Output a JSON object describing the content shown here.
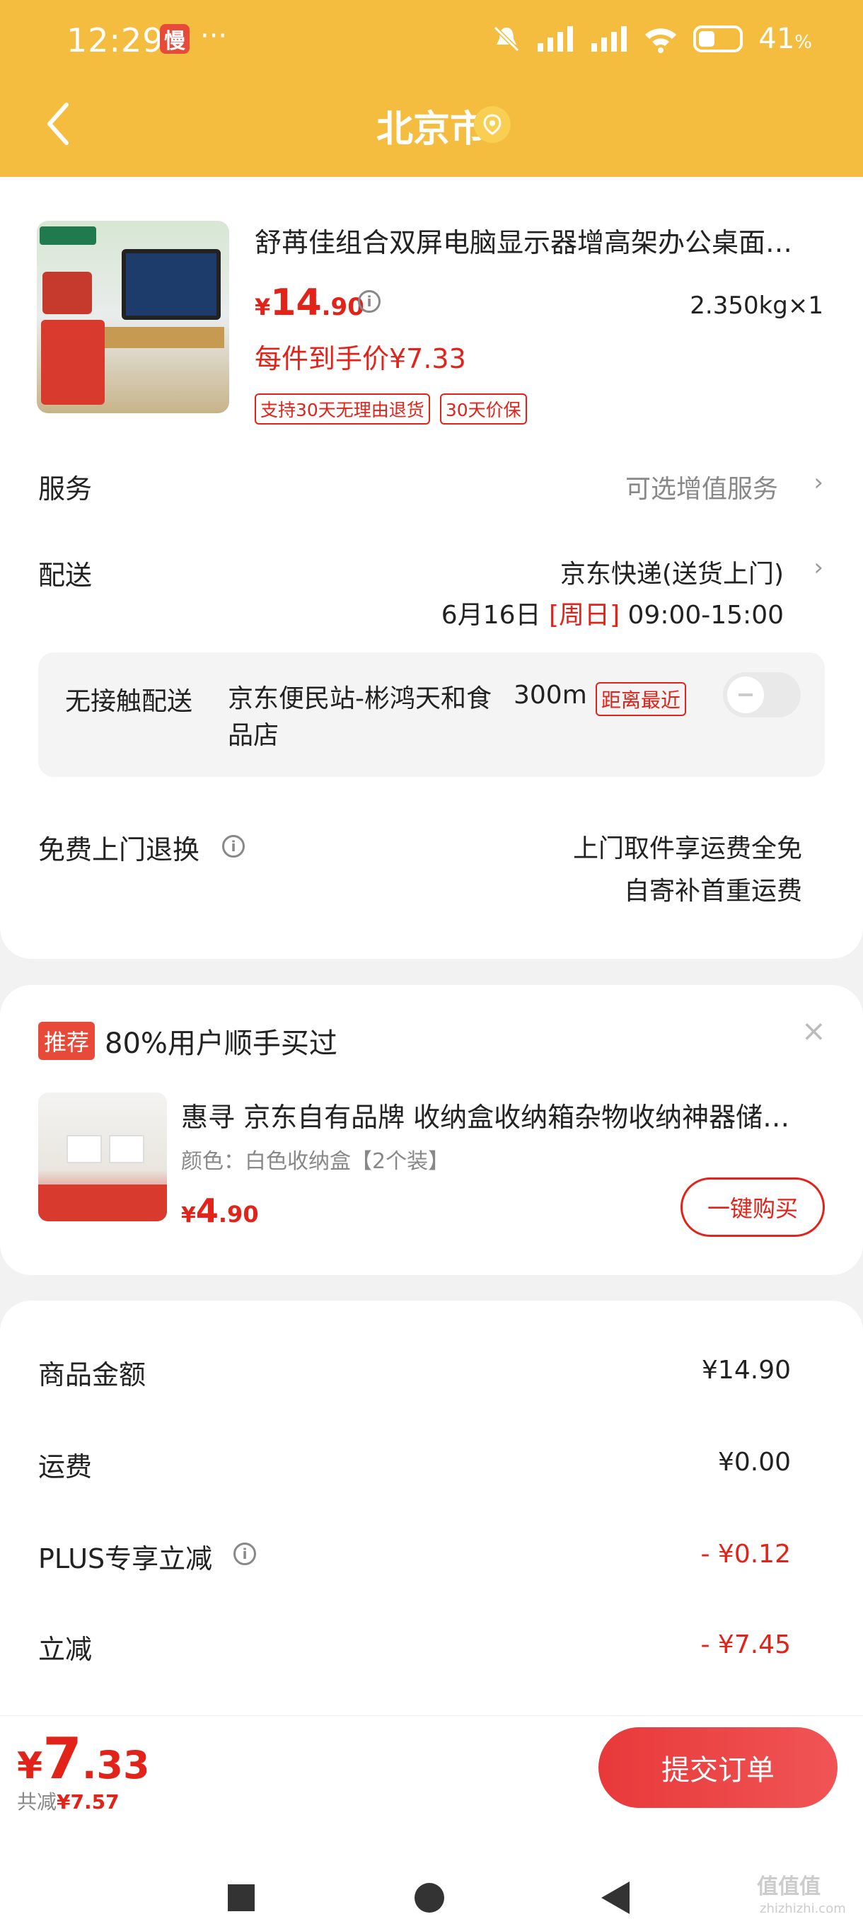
{
  "status_bar": {
    "time": "12:29",
    "badge": "慢",
    "dots": "···",
    "battery": "41",
    "battery_unit": "%"
  },
  "header": {
    "title": "北京市"
  },
  "product": {
    "title": "舒苒佳组合双屏电脑显示器增高架办公桌面…",
    "price_symbol": "¥",
    "price_int": "14",
    "price_dec": ".90",
    "weight": "2.350kg×1",
    "unit_price": "每件到手价¥7.33",
    "tags": [
      "支持30天无理由退货",
      "30天价保"
    ]
  },
  "service": {
    "label": "服务",
    "value": "可选增值服务"
  },
  "delivery": {
    "label": "配送",
    "method": "京东快递(送货上门)",
    "date": "6月16日",
    "day": "[周日]",
    "time": "09:00-15:00"
  },
  "contactless": {
    "label": "无接触配送",
    "store": "京东便民站-彬鸿天和食品店",
    "distance": "300m",
    "tag": "距离最近",
    "enabled": false
  },
  "free_return": {
    "label": "免费上门退换",
    "line1": "上门取件享运费全免",
    "line2": "自寄补首重运费"
  },
  "recommend": {
    "badge": "推荐",
    "text": "80%用户顺手买过",
    "close": "×",
    "title": "惠寻 京东自有品牌 收纳盒收纳箱杂物收纳神器储…",
    "color": "颜色：白色收纳盒【2个装】",
    "price_symbol": "¥",
    "price_int": "4",
    "price_dec": ".90",
    "button": "一键购买"
  },
  "summary": {
    "goods_label": "商品金额",
    "goods_value": "¥14.90",
    "shipping_label": "运费",
    "shipping_value": "¥0.00",
    "plus_label": "PLUS专享立减",
    "plus_value": "- ¥0.12",
    "discount_label": "立减",
    "discount_value": "- ¥7.45"
  },
  "footer": {
    "total_symbol": "¥",
    "total_int": "7",
    "total_dec": ".33",
    "saved_label": "共减",
    "saved_value": "¥7.57",
    "submit": "提交订单"
  },
  "watermark": {
    "text": "值值值",
    "sub": "zhizhizhi.com"
  },
  "colors": {
    "accent": "#e2231a",
    "header": "#f5bd3f"
  }
}
